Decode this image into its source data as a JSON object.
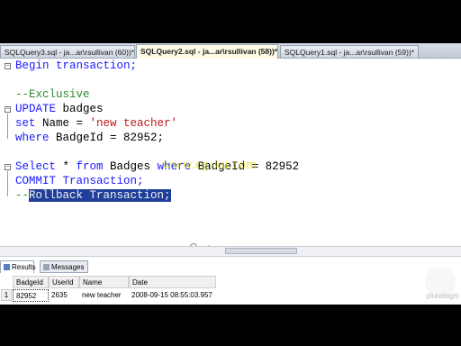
{
  "tabs": [
    {
      "label": "SQLQuery3.sql - ja...ar\\rsullivan (60))*"
    },
    {
      "label": "SQLQuery2.sql - ja...ar\\rsullivan (58))*"
    },
    {
      "label": "SQLQuery1.sql - ja...ar\\rsullivan (59))*"
    }
  ],
  "editor": {
    "l1": {
      "kw": "Begin transaction;"
    },
    "l3": {
      "cm": "--Exclusive"
    },
    "l4": {
      "kw": "UPDATE",
      "txt": " badges"
    },
    "l5": {
      "kw": "set",
      "txt": " Name = ",
      "str": "'new teacher'"
    },
    "l6": {
      "kw": "where",
      "txt": " BadgeId = 82952;"
    },
    "l8": {
      "kw1": "Select",
      "txt1": " * ",
      "kw2": "from",
      "txt2": " Badges ",
      "kw3": "where",
      "txt3": " BadgeId = 82952"
    },
    "l9": {
      "kw": "COMMIT Transaction;"
    },
    "l10": {
      "cm": "--",
      "sel": "Rollback Transaction;"
    }
  },
  "watermark": "www.cg-ku.com",
  "results": {
    "tabs": [
      {
        "label": "Results"
      },
      {
        "label": "Messages"
      }
    ],
    "columns": [
      "BadgeId",
      "UserId",
      "Name",
      "Date"
    ],
    "row_number": "1",
    "rows": [
      [
        "82952",
        "2635",
        "new teacher",
        "2008-09-15 08:55:03.957"
      ]
    ]
  },
  "logo_text": "pluralsight"
}
